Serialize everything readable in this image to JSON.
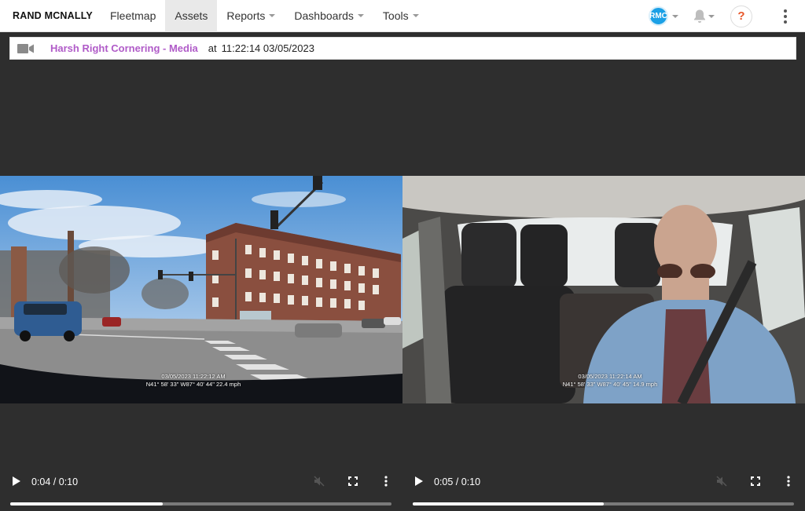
{
  "brand": {
    "logo_text": "RAND MCNALLY"
  },
  "nav": {
    "items": [
      {
        "label": "Fleetmap",
        "active": false,
        "dropdown": false
      },
      {
        "label": "Assets",
        "active": true,
        "dropdown": false
      },
      {
        "label": "Reports",
        "active": false,
        "dropdown": true
      },
      {
        "label": "Dashboards",
        "active": false,
        "dropdown": true
      },
      {
        "label": "Tools",
        "active": false,
        "dropdown": true
      }
    ],
    "user_initials": "RMC",
    "help_label": "?"
  },
  "event": {
    "title": "Harsh Right Cornering - Media",
    "at_label": "at",
    "timestamp": "11:22:14 03/05/2023"
  },
  "videos": [
    {
      "name": "road-facing",
      "overlay_line1": "03/05/2023 11:22:12 AM",
      "overlay_line2": "N41° 58' 33\" W87° 40' 44\" 22.4 mph",
      "time": "0:04 / 0:10",
      "progress": 0.4
    },
    {
      "name": "driver-facing",
      "overlay_line1": "03/05/2023 11:22:14 AM",
      "overlay_line2": "N41° 58' 33\" W87° 40' 45\" 14.9 mph",
      "time": "0:05 / 0:10",
      "progress": 0.5
    }
  ],
  "colors": {
    "accent": "#b05bc8",
    "avatar": "#1aa0e6",
    "help": "#e8572a",
    "video_bg": "#2e2e2e"
  },
  "icons": [
    "video-camera-icon",
    "bell-icon",
    "help-icon",
    "more-vert-icon",
    "play-icon",
    "mute-icon",
    "fullscreen-icon"
  ]
}
